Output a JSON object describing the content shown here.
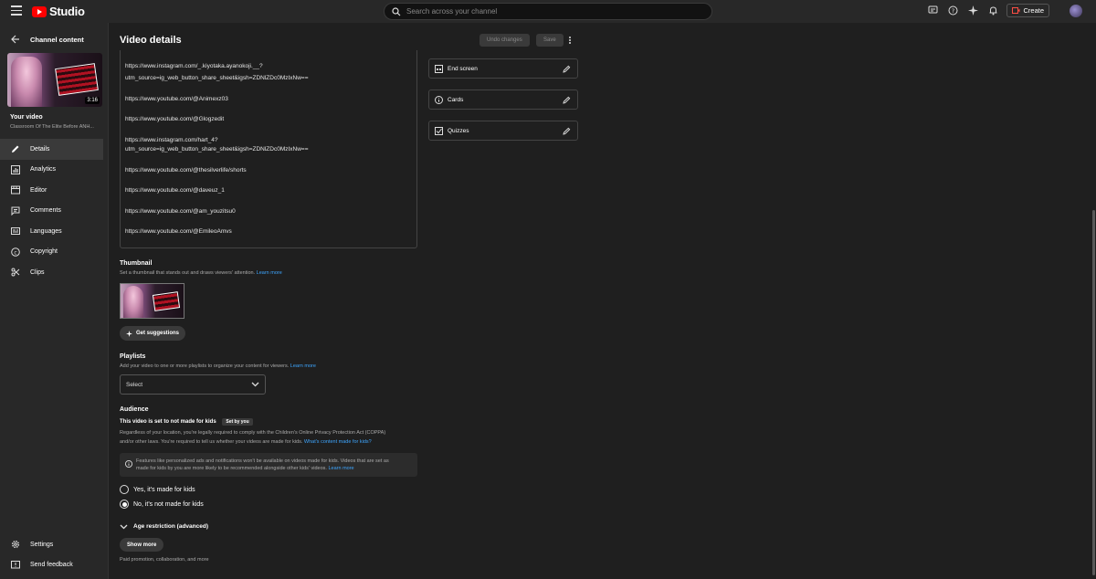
{
  "app": {
    "logo_text": "Studio"
  },
  "search": {
    "placeholder": "Search across your channel"
  },
  "topbar": {
    "create_label": "Create"
  },
  "sidebar": {
    "header": "Channel content",
    "thumbnail_duration": "3:16",
    "your_video_label": "Your video",
    "video_title": "Classroom Of The Elite Before ANH...",
    "items": [
      {
        "label": "Details",
        "icon": "pencil-icon"
      },
      {
        "label": "Analytics",
        "icon": "analytics-icon"
      },
      {
        "label": "Editor",
        "icon": "editor-icon"
      },
      {
        "label": "Comments",
        "icon": "comments-icon"
      },
      {
        "label": "Languages",
        "icon": "languages-icon"
      },
      {
        "label": "Copyright",
        "icon": "copyright-icon"
      },
      {
        "label": "Clips",
        "icon": "scissors-icon"
      }
    ],
    "bottom": [
      {
        "label": "Settings",
        "icon": "gear-icon"
      },
      {
        "label": "Send feedback",
        "icon": "feedback-icon"
      }
    ]
  },
  "main": {
    "title": "Video details",
    "undo_label": "Undo changes",
    "save_label": "Save",
    "description_lines": [
      "https://www.instagram.com/_.kiyotaka.ayanokoji.__?",
      "utm_source=ig_web_button_share_sheet&igsh=ZDNlZDc0MzIxNw==",
      "https://www.youtube.com/@Animexz03",
      "https://www.youtube.com/@Glogzedit",
      "https://www.instagram.com/hart_4?",
      "utm_source=ig_web_button_share_sheet&igsh=ZDNlZDc0MzIxNw==",
      "https://www.youtube.com/@thesilverlife/shorts",
      "https://www.youtube.com/@daveuz_1",
      "https://www.youtube.com/@am_youzitsu0",
      "https://www.youtube.com/@EmileoAmvs"
    ],
    "right_cards": [
      {
        "label": "End screen",
        "icon": "end-screen-icon"
      },
      {
        "label": "Cards",
        "icon": "info-icon"
      },
      {
        "label": "Quizzes",
        "icon": "quiz-icon"
      }
    ],
    "thumbnail": {
      "title": "Thumbnail",
      "subtitle": "Set a thumbnail that stands out and draws viewers' attention.",
      "learn_more": "Learn more",
      "suggest_label": "Get suggestions"
    },
    "playlists": {
      "title": "Playlists",
      "subtitle": "Add your video to one or more playlists to organize your content for viewers.",
      "learn_more": "Learn more",
      "select_value": "Select"
    },
    "audience": {
      "title": "Audience",
      "status": "This video is set to not made for kids",
      "badge": "Set by you",
      "text1": "Regardless of your location, you're legally required to comply with the Children's Online Privacy Protection Act (COPPA)",
      "text2": "and/or other laws. You're required to tell us whether your videos are made for kids.",
      "text2_link": "What's content made for kids?",
      "info1": "Features like personalized ads and notifications won't be available on videos made for kids. Videos that are set as",
      "info2": "made for kids by you are more likely to be recommended alongside other kids' videos.",
      "info_link": "Learn more",
      "option_yes": "Yes, it's made for kids",
      "option_no": "No, it's not made for kids",
      "selected": "no",
      "age_restriction": "Age restriction (advanced)",
      "show_more": "Show more",
      "footer": "Paid promotion, collaboration, and more"
    }
  },
  "colors": {
    "accent_link": "#3ea6ff",
    "logo_red": "#ff0000"
  }
}
